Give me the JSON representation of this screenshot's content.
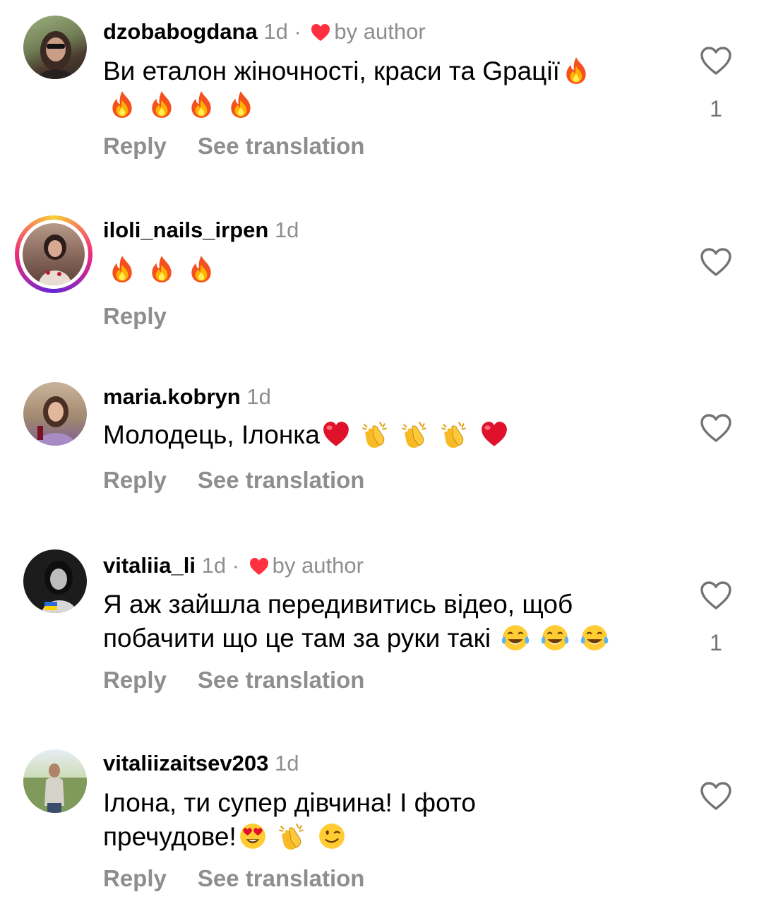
{
  "comments": [
    {
      "username": "dzobabogdana",
      "time": "1d",
      "separator": "·",
      "liked_by_author": true,
      "by_author_label": "by author",
      "text_line1": "Ви еталон жіночності, краси та Gрації",
      "emojis_line1": [
        "fire"
      ],
      "emojis_line2": [
        "fire",
        "fire",
        "fire",
        "fire"
      ],
      "actions": [
        "Reply",
        "See translation"
      ],
      "like_count": "1"
    },
    {
      "username": "iloli_nails_irpen",
      "time": "1d",
      "has_story_ring": true,
      "emojis_line1": [
        "fire",
        "fire",
        "fire"
      ],
      "actions": [
        "Reply"
      ],
      "like_count": ""
    },
    {
      "username": "maria.kobryn",
      "time": "1d",
      "text_line1": "Молодець, Ілонка",
      "emojis_line1": [
        "red-heart",
        "clapping-hands",
        "clapping-hands",
        "clapping-hands",
        "red-heart"
      ],
      "actions": [
        "Reply",
        "See translation"
      ],
      "like_count": ""
    },
    {
      "username": "vitaliia_li",
      "time": "1d",
      "separator": "·",
      "liked_by_author": true,
      "by_author_label": "by author",
      "text_line1": "Я аж зайшла передивитись відео, щоб",
      "text_line2": "побачити що це там за руки такі",
      "emojis_line2": [
        "tears-of-joy",
        "tears-of-joy",
        "tears-of-joy"
      ],
      "actions": [
        "Reply",
        "See translation"
      ],
      "like_count": "1"
    },
    {
      "username": "vitaliizaitsev203",
      "time": "1d",
      "text_line1": "Ілона, ти супер дівчина! І фото",
      "text_line2": "пречудове!",
      "emojis_line2": [
        "heart-eyes",
        "clapping-hands",
        "winking-face"
      ],
      "actions": [
        "Reply",
        "See translation"
      ],
      "like_count": ""
    }
  ],
  "colors": {
    "text": "#000000",
    "muted": "#8e8e8e",
    "heart_red": "#ff3040",
    "story_ring": [
      "#f9ce34",
      "#ee2a7b",
      "#6228d7"
    ]
  }
}
